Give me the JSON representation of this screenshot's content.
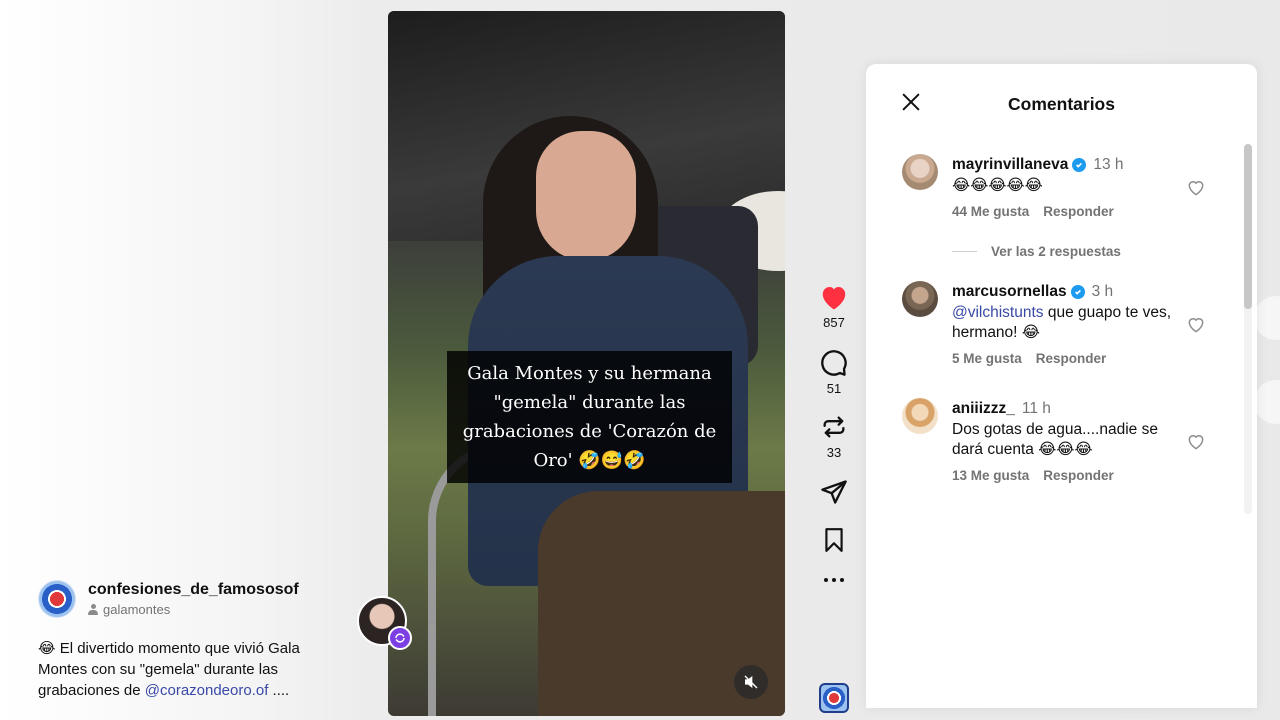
{
  "post": {
    "author": "confesiones_de_famososof",
    "collaborator": "galamontes",
    "caption_prefix": "😂 El divertido momento que vivió Gala Montes con su \"gemela\" durante las grabaciones de ",
    "caption_mention": "@corazondeoro.of",
    "caption_suffix": " ...."
  },
  "video": {
    "subtitle": "Gala Montes y su hermana \"gemela\" durante las grabaciones de 'Corazón de Oro' 🤣😅🤣"
  },
  "actions": {
    "likes": "857",
    "comments": "51",
    "reposts": "33"
  },
  "comments_panel": {
    "title": "Comentarios",
    "comments": [
      {
        "user": "mayrinvillaneva",
        "verified": true,
        "time": "13 h",
        "text": "😂😂😂😂😂",
        "likes": "44 Me gusta",
        "reply": "Responder",
        "view_replies": "Ver las 2 respuestas"
      },
      {
        "user": "marcusornellas",
        "verified": true,
        "time": "3 h",
        "mention": "@vilchistunts",
        "text": " que guapo te ves, hermano! 😂",
        "likes": "5 Me gusta",
        "reply": "Responder"
      },
      {
        "user": "aniiizzz_",
        "verified": false,
        "time": "11 h",
        "text": "Dos gotas de agua....nadie se dará cuenta 😂😂😂",
        "likes": "13 Me gusta",
        "reply": "Responder"
      }
    ]
  },
  "icons": [
    "person-icon",
    "mute-icon",
    "repost-badge-icon",
    "heart-icon",
    "comment-icon",
    "repost-icon",
    "share-icon",
    "bookmark-icon",
    "more-icon",
    "close-icon",
    "verified-icon",
    "like-heart-icon"
  ],
  "colors": {
    "like_red": "#ff3040",
    "mention_blue": "#3949a8",
    "verified_blue": "#1d9bf0",
    "muted_text": "#737373"
  }
}
